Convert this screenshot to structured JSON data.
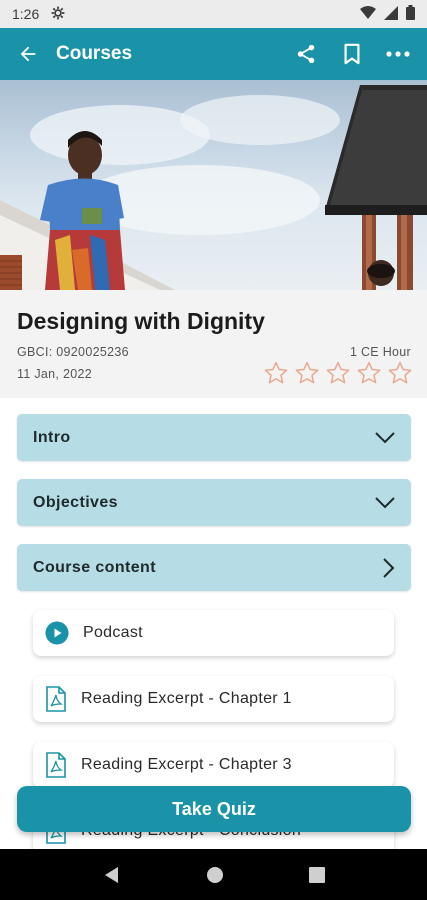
{
  "status_bar": {
    "time": "1:26"
  },
  "app_bar": {
    "title": "Courses"
  },
  "course": {
    "title": "Designing with Dignity",
    "gbci": "GBCI: 0920025236",
    "date": "11 Jan, 2022",
    "ce_hours": "1 CE Hour",
    "rating": 0,
    "rating_max": 5
  },
  "sections": [
    {
      "label": "Intro",
      "state": "collapsed"
    },
    {
      "label": "Objectives",
      "state": "collapsed"
    },
    {
      "label": "Course content",
      "state": "navigate"
    }
  ],
  "content_items": [
    {
      "label": "Podcast",
      "icon": "play-circle-icon"
    },
    {
      "label": "Reading Excerpt - Chapter 1",
      "icon": "pdf-icon"
    },
    {
      "label": "Reading Excerpt - Chapter 3",
      "icon": "pdf-icon"
    },
    {
      "label": "Reading Excerpt - Conclusion",
      "icon": "pdf-icon"
    }
  ],
  "quiz_button": {
    "label": "Take Quiz"
  },
  "colors": {
    "brand": "#1a93a9",
    "accordion": "#b6dde5",
    "star_outline": "#e9a98f"
  }
}
